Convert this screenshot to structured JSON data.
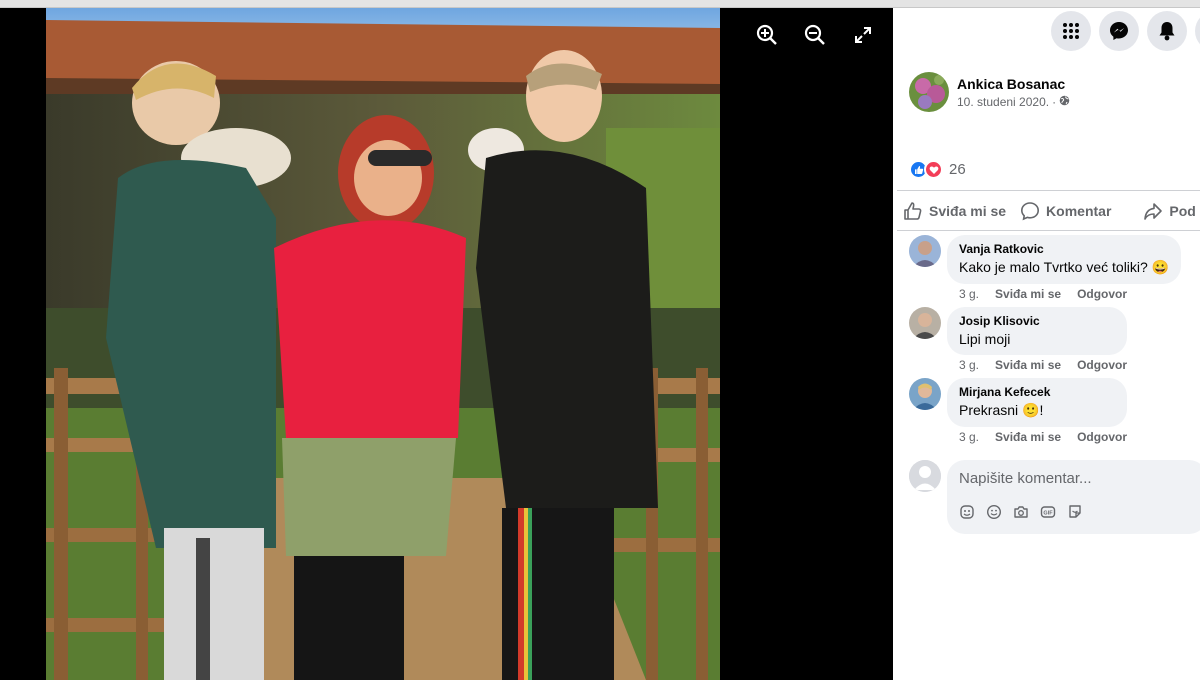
{
  "viewer": {
    "tools": [
      {
        "icon": "zoom-in-icon"
      },
      {
        "icon": "zoom-out-icon"
      },
      {
        "icon": "fullscreen-icon"
      }
    ]
  },
  "nav": {
    "buttons": [
      {
        "icon": "menu-grid-icon"
      },
      {
        "icon": "messenger-icon"
      },
      {
        "icon": "notifications-bell-icon"
      }
    ]
  },
  "post": {
    "author": "Ankica Bosanac",
    "date": "10. studeni 2020.",
    "separator": "·",
    "privacy_icon": "globe-icon",
    "reactions": {
      "icons": [
        "like-icon",
        "love-icon"
      ],
      "count": "26"
    },
    "actions": {
      "like_label": "Sviđa mi se",
      "comment_label": "Komentar",
      "share_label": "Pod"
    }
  },
  "comments": [
    {
      "name": "Vanja Ratkovic",
      "text": "Kako je malo Tvrtko već toliki?",
      "emoji": "😀",
      "time": "3 g.",
      "like": "Sviđa mi se",
      "reply": "Odgovor"
    },
    {
      "name": "Josip Klisovic",
      "text": "Lipi moji",
      "emoji": "",
      "time": "3 g.",
      "like": "Sviđa mi se",
      "reply": "Odgovor"
    },
    {
      "name": "Mirjana Kefecek",
      "text": "Prekrasni",
      "emoji": "🙂",
      "suffix": "!",
      "time": "3 g.",
      "like": "Sviđa mi se",
      "reply": "Odgovor"
    }
  ],
  "composer": {
    "placeholder": "Napišite komentar...",
    "tools": [
      "avatar-sticker-icon",
      "emoji-icon",
      "camera-icon",
      "gif-icon",
      "sticker-icon"
    ]
  },
  "colors": {
    "accent": "#1877f2",
    "love": "#f33e58",
    "secondary_text": "#65676b",
    "bubble": "#f0f2f5"
  }
}
